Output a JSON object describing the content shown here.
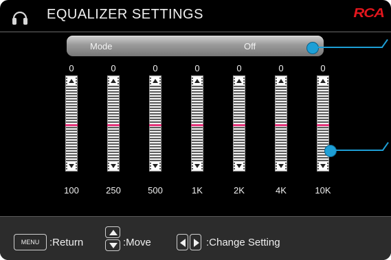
{
  "header": {
    "title": "EQUALIZER SETTINGS",
    "brand": "RCA"
  },
  "mode": {
    "label": "Mode",
    "value": "Off"
  },
  "bands": [
    {
      "label": "100",
      "value": "0"
    },
    {
      "label": "250",
      "value": "0"
    },
    {
      "label": "500",
      "value": "0"
    },
    {
      "label": "1K",
      "value": "0"
    },
    {
      "label": "2K",
      "value": "0"
    },
    {
      "label": "4K",
      "value": "0"
    },
    {
      "label": "10K",
      "value": "0"
    }
  ],
  "footer": {
    "menu_key": "MENU",
    "return_label": ":Return",
    "move_label": ":Move",
    "change_label": ":Change Setting"
  },
  "colors": {
    "background": "#000000",
    "level_marker": "#e5337a",
    "callout": "#1d9fd6",
    "brand": "#e3161d"
  },
  "icons": [
    "headset-icon",
    "up-arrow-icon",
    "down-arrow-icon",
    "left-arrow-icon",
    "right-arrow-icon"
  ]
}
